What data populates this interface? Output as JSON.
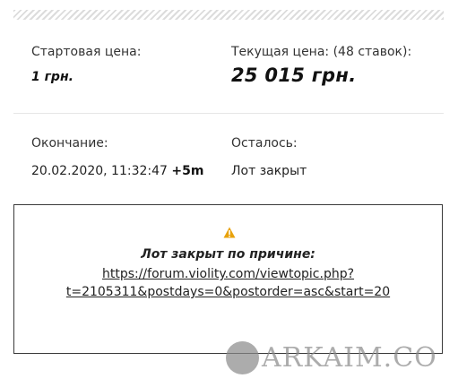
{
  "auction": {
    "start_price_label": "Стартовая цена:",
    "start_price_value": "1 грн.",
    "current_price_label": "Текущая цена: (48 ставок):",
    "current_price_value": "25 015 грн.",
    "end_label": "Окончание:",
    "end_datetime": "20.02.2020, 11:32:47",
    "end_extension": "+5m",
    "remaining_label": "Осталось:",
    "remaining_value": "Лот закрыт"
  },
  "closed_notice": {
    "icon": "warning-icon",
    "icon_color": "#e8a20c",
    "title": "Лот закрыт по причине:",
    "link_line1": "https://forum.violity.com/viewtopic.php?",
    "link_line2": "t=2105311&postdays=0&postorder=asc&start=20"
  },
  "watermark": {
    "text": "ARKAIM.CO"
  }
}
